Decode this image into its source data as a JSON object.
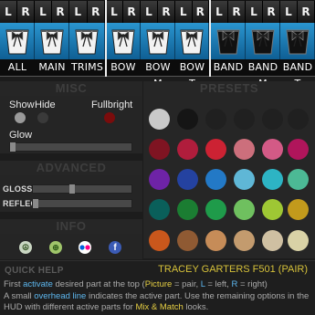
{
  "parts": [
    {
      "label": "ALL",
      "lr": [
        "L",
        "R"
      ],
      "style": "white"
    },
    {
      "label": "MAIN",
      "lr": [
        "L",
        "R"
      ],
      "style": "white"
    },
    {
      "label": "TRIMS",
      "lr": [
        "L",
        "R"
      ],
      "style": "white"
    },
    {
      "label": "BOW",
      "lr": [
        "L",
        "R"
      ],
      "style": "white"
    },
    {
      "label": "BOW M",
      "lr": [
        "L",
        "R"
      ],
      "style": "white"
    },
    {
      "label": "BOW T",
      "lr": [
        "L",
        "R"
      ],
      "style": "white"
    },
    {
      "label": "BAND",
      "lr": [
        "L",
        "R"
      ],
      "style": "black"
    },
    {
      "label": "BAND M",
      "lr": [
        "L",
        "R"
      ],
      "style": "black"
    },
    {
      "label": "BAND T",
      "lr": [
        "L",
        "R"
      ],
      "style": "black"
    }
  ],
  "misc": {
    "title": "MISC",
    "show": "Show",
    "hide": "Hide",
    "fullbright": "Fullbright",
    "glow": "Glow",
    "glow_level": 0.0
  },
  "advanced": {
    "title": "ADVANCED",
    "gloss": "GLOSS",
    "gloss_level": 0.38,
    "reflect": "REFLECT",
    "reflect_level": 0.0
  },
  "info": {
    "title": "INFO",
    "icons": [
      "peace-icon",
      "globe-icon",
      "flickr-icon",
      "facebook-icon"
    ]
  },
  "presets": {
    "title": "PRESETS",
    "colors": [
      [
        "#c9c9c9",
        "#151515",
        "#202020",
        "#202020",
        "#202020",
        "#202020"
      ],
      [
        "#7f1422",
        "#b01d3c",
        "#cc2233",
        "#cc6f7c",
        "#d35a86",
        "#b0155b"
      ],
      [
        "#6e23a6",
        "#2442a0",
        "#2379c6",
        "#5fb7d6",
        "#2db4c4",
        "#4cb995"
      ],
      [
        "#0a5f5a",
        "#1b7d32",
        "#1f9b4a",
        "#6fc05f",
        "#9ec734",
        "#c29a1c"
      ],
      [
        "#c9571c",
        "#8f5a33",
        "#c68c58",
        "#c39b6e",
        "#cfc0a2",
        "#d9d2a6"
      ]
    ]
  },
  "help": {
    "title": "QUICK HELP",
    "product": "TRACEY GARTERS F501 (PAIR)",
    "t1": "First ",
    "k1": "activate",
    "t2": " desired part at the top (",
    "k2": "Picture",
    "t3": " = pair, ",
    "k3": "L",
    "t4": " = left, ",
    "k4": "R",
    "t5": " = right)",
    "t6": "A small ",
    "k5": "overhead line",
    "t7": " indicates the active part. Use the remaining options in the HUD with different active parts for ",
    "k6": "Mix & Match",
    "t8": " looks."
  }
}
